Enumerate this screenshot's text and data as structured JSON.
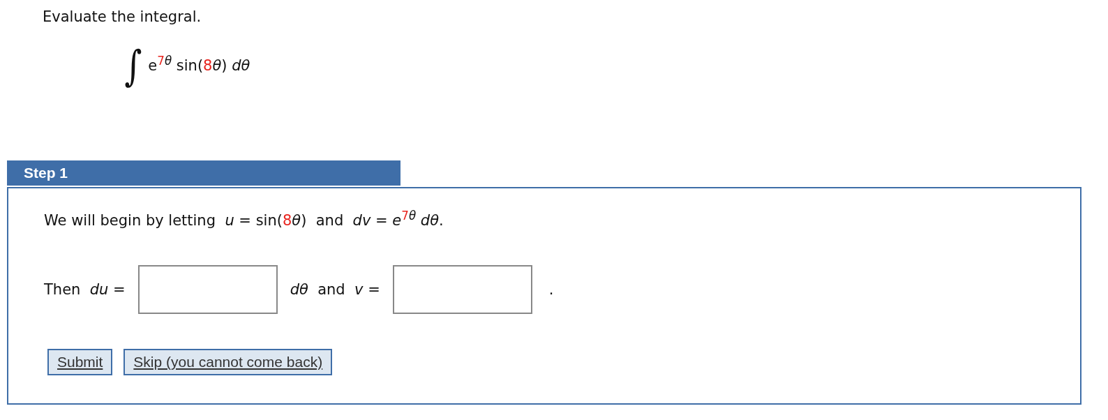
{
  "prompt": "Evaluate the integral.",
  "integral": {
    "sign": "∫",
    "parts": [
      {
        "kind": "plain",
        "text": "e"
      },
      {
        "kind": "sup",
        "parts": [
          {
            "kind": "red",
            "text": "7"
          },
          {
            "kind": "italic",
            "text": "θ"
          }
        ]
      },
      {
        "kind": "plain",
        "text": " sin("
      },
      {
        "kind": "red",
        "text": "8"
      },
      {
        "kind": "italic",
        "text": "θ"
      },
      {
        "kind": "plain",
        "text": ") "
      },
      {
        "kind": "italic",
        "text": "dθ"
      }
    ]
  },
  "step": {
    "title": "Step 1",
    "sentence": [
      {
        "kind": "plain",
        "text": "We will begin by letting  "
      },
      {
        "kind": "italic",
        "text": "u"
      },
      {
        "kind": "plain",
        "text": " = sin("
      },
      {
        "kind": "red",
        "text": "8"
      },
      {
        "kind": "italic",
        "text": "θ"
      },
      {
        "kind": "plain",
        "text": ")  and  "
      },
      {
        "kind": "italic",
        "text": "dv"
      },
      {
        "kind": "plain",
        "text": " = "
      },
      {
        "kind": "italic",
        "text": "e"
      },
      {
        "kind": "sup",
        "parts": [
          {
            "kind": "red",
            "text": "7"
          },
          {
            "kind": "italic",
            "text": "θ"
          }
        ]
      },
      {
        "kind": "italic",
        "text": " dθ"
      },
      {
        "kind": "plain",
        "text": "."
      }
    ],
    "answer_line": {
      "label_1": [
        {
          "kind": "plain",
          "text": "Then  "
        },
        {
          "kind": "italic",
          "text": "du"
        },
        {
          "kind": "plain",
          "text": " ="
        }
      ],
      "label_2": [
        {
          "kind": "italic",
          "text": "dθ"
        },
        {
          "kind": "plain",
          "text": "  and  "
        },
        {
          "kind": "italic",
          "text": "v"
        },
        {
          "kind": "plain",
          "text": " ="
        }
      ],
      "end": "."
    },
    "buttons": [
      "Submit",
      "Skip (you cannot come back)"
    ]
  }
}
